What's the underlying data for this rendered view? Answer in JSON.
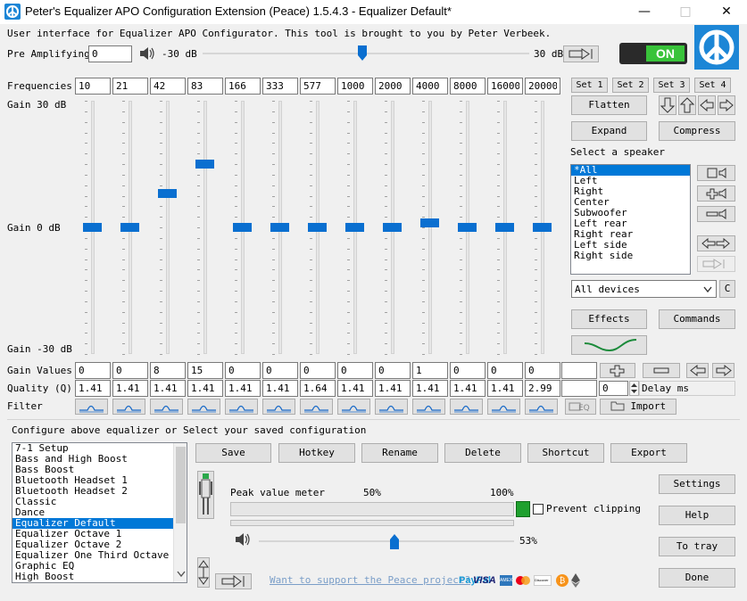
{
  "window": {
    "title": "Peter's Equalizer APO Configuration Extension (Peace) 1.5.4.3 - Equalizer Default*",
    "minimize_glyph": "—",
    "maximize_glyph": "□",
    "close_glyph": "✕"
  },
  "intro": "User interface for Equalizer APO Configurator. This tool is brought to you by Peter Verbeek.",
  "preamp": {
    "label": "Pre Amplifying",
    "value": "0",
    "min_label": "-30 dB",
    "max_label": "30 dB"
  },
  "power": {
    "label": "ON"
  },
  "frequencies": {
    "label": "Frequencies",
    "values": [
      "10",
      "21",
      "42",
      "83",
      "166",
      "333",
      "577",
      "1000",
      "2000",
      "4000",
      "8000",
      "16000",
      "20000"
    ]
  },
  "sets": [
    "Set 1",
    "Set 2",
    "Set 3",
    "Set 4"
  ],
  "gain_labels": {
    "top": "Gain 30 dB",
    "mid": "Gain 0 dB",
    "bottom": "Gain -30 dB"
  },
  "gain_values": {
    "label": "Gain Values",
    "values": [
      "0",
      "0",
      "8",
      "15",
      "0",
      "0",
      "0",
      "0",
      "0",
      "1",
      "0",
      "0",
      "0"
    ]
  },
  "quality": {
    "label": "Quality (Q)",
    "values": [
      "1.41",
      "1.41",
      "1.41",
      "1.41",
      "1.41",
      "1.41",
      "1.64",
      "1.41",
      "1.41",
      "1.41",
      "1.41",
      "1.41",
      "2.99"
    ]
  },
  "delay": {
    "value": "0",
    "label": "Delay ms"
  },
  "filter": {
    "label": "Filter",
    "import_label": "Import"
  },
  "buttons": {
    "flatten": "Flatten",
    "expand": "Expand",
    "compress": "Compress",
    "effects": "Effects",
    "commands": "Commands",
    "save": "Save",
    "hotkey": "Hotkey",
    "rename": "Rename",
    "delete": "Delete",
    "shortcut": "Shortcut",
    "export": "Export",
    "settings": "Settings",
    "help": "Help",
    "to_tray": "To tray",
    "done": "Done",
    "device_c": "C"
  },
  "speaker": {
    "heading": "Select a speaker",
    "items": [
      "*All",
      "Left",
      "Right",
      "Center",
      "Subwoofer",
      "Left rear",
      "Right rear",
      "Left side",
      "Right side"
    ],
    "selected": 0
  },
  "device": {
    "selected": "All devices"
  },
  "config": {
    "heading": "Configure above equalizer or Select your saved configuration",
    "items": [
      "7-1 Setup",
      "Bass and High Boost",
      "Bass Boost",
      "Bluetooth Headset 1",
      "Bluetooth Headset 2",
      "Classic",
      "Dance",
      "Equalizer Default",
      "Equalizer Octave 1",
      "Equalizer Octave 2",
      "Equalizer One Third Octave",
      "Graphic EQ",
      "High Boost"
    ],
    "selected": 7
  },
  "meter": {
    "label": "Peak value meter",
    "mark_50": "50%",
    "mark_100": "100%",
    "prevent_clipping": "Prevent clipping"
  },
  "volume": {
    "value_label": "53%",
    "level": 0.53
  },
  "support_link": "Want to support the Peace project?",
  "payments": [
    "PayPal",
    "VISA",
    "AMEX",
    "MasterCard",
    "Discover",
    "Bitcoin",
    "Ethereum"
  ],
  "icons": [
    "speaker-icon",
    "arrow-icon",
    "peace-icon",
    "move-icon"
  ],
  "colors": {
    "accent": "#0a6fd0",
    "power_on": "#39c33a",
    "selection": "#0078d7",
    "link": "#7a9ec8"
  }
}
